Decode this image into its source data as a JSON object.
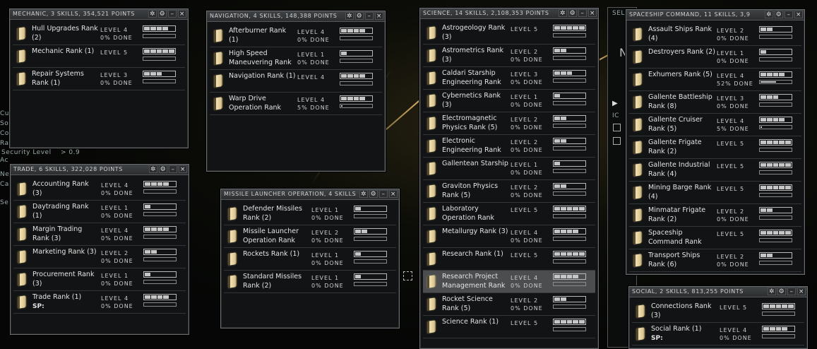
{
  "windows": {
    "mechanic": {
      "title": "MECHANIC, 3 SKILLS, 354,521 POINTS",
      "skills": [
        {
          "name": "Hull Upgrades Rank (2)",
          "level": "LEVEL 4",
          "done": "0% DONE",
          "lv": 4,
          "pct": 0
        },
        {
          "name": "Mechanic Rank (1)",
          "level": "LEVEL 5",
          "done": "",
          "lv": 5,
          "pct": 0
        },
        {
          "name": "Repair Systems Rank (1)",
          "level": "LEVEL 3",
          "done": "0% DONE",
          "lv": 3,
          "pct": 0
        }
      ]
    },
    "navigation": {
      "title": "NAVIGATION, 4 SKILLS, 148,388 POINTS",
      "skills": [
        {
          "name": "Afterburner Rank (1)",
          "level": "LEVEL 4",
          "done": "0% DONE",
          "lv": 4,
          "pct": 0
        },
        {
          "name": "High Speed Maneuvering Rank",
          "level": "LEVEL 1",
          "done": "0% DONE",
          "lv": 1,
          "pct": 0
        },
        {
          "name": "Navigation Rank (1)",
          "level": "LEVEL 4",
          "done": "",
          "lv": 4,
          "pct": 0
        },
        {
          "name": "Warp Drive Operation Rank",
          "level": "LEVEL 4",
          "done": "5% DONE",
          "lv": 4,
          "pct": 5
        }
      ]
    },
    "science": {
      "title": "SCIENCE, 14 SKILLS, 2,108,353 POINTS",
      "skills": [
        {
          "name": "Astrogeology Rank (3)",
          "level": "LEVEL 5",
          "done": "",
          "lv": 5,
          "pct": 0
        },
        {
          "name": "Astrometrics Rank (3)",
          "level": "LEVEL 2",
          "done": "0% DONE",
          "lv": 2,
          "pct": 0
        },
        {
          "name": "Caldari Starship Engineering Rank",
          "level": "LEVEL 3",
          "done": "0% DONE",
          "lv": 3,
          "pct": 0
        },
        {
          "name": "Cybernetics Rank (3)",
          "level": "LEVEL 1",
          "done": "0% DONE",
          "lv": 1,
          "pct": 0
        },
        {
          "name": "Electromagnetic Physics Rank (5)",
          "level": "LEVEL 2",
          "done": "0% DONE",
          "lv": 2,
          "pct": 0
        },
        {
          "name": "Electronic Engineering Rank",
          "level": "LEVEL 2",
          "done": "0% DONE",
          "lv": 2,
          "pct": 0
        },
        {
          "name": "Gallentean Starship",
          "level": "LEVEL 1",
          "done": "0% DONE",
          "lv": 1,
          "pct": 0
        },
        {
          "name": "Graviton Physics Rank (5)",
          "level": "LEVEL 2",
          "done": "0% DONE",
          "lv": 2,
          "pct": 0
        },
        {
          "name": "Laboratory Operation Rank",
          "level": "LEVEL 5",
          "done": "",
          "lv": 5,
          "pct": 0
        },
        {
          "name": "Metallurgy Rank (3)",
          "level": "LEVEL 4",
          "done": "0% DONE",
          "lv": 4,
          "pct": 0
        },
        {
          "name": "Research Rank (1)",
          "level": "LEVEL 5",
          "done": "",
          "lv": 5,
          "pct": 0
        },
        {
          "name": "Research Project Management Rank",
          "level": "LEVEL 4",
          "done": "0% DONE",
          "lv": 4,
          "pct": 0,
          "selected": true
        },
        {
          "name": "Rocket Science Rank (5)",
          "level": "LEVEL 2",
          "done": "0% DONE",
          "lv": 2,
          "pct": 0
        },
        {
          "name": "Science Rank (1)",
          "level": "LEVEL 5",
          "done": "",
          "lv": 5,
          "pct": 0
        }
      ]
    },
    "spaceship": {
      "title": "SPACESHIP COMMAND, 11 SKILLS, 3,9",
      "skills": [
        {
          "name": "Assault Ships Rank (4)",
          "level": "LEVEL 2",
          "done": "0% DONE",
          "lv": 2,
          "pct": 0
        },
        {
          "name": "Destroyers Rank (2)",
          "level": "LEVEL 1",
          "done": "0% DONE",
          "lv": 1,
          "pct": 0
        },
        {
          "name": "Exhumers Rank (5)",
          "level": "LEVEL 4",
          "done": "52% DONE",
          "lv": 4,
          "pct": 52
        },
        {
          "name": "Gallente Battleship Rank (8)",
          "level": "LEVEL 3",
          "done": "0% DONE",
          "lv": 3,
          "pct": 0
        },
        {
          "name": "Gallente Cruiser Rank (5)",
          "level": "LEVEL 4",
          "done": "5% DONE",
          "lv": 4,
          "pct": 5
        },
        {
          "name": "Gallente Frigate Rank (2)",
          "level": "LEVEL 5",
          "done": "",
          "lv": 5,
          "pct": 0
        },
        {
          "name": "Gallente Industrial Rank (4)",
          "level": "LEVEL 5",
          "done": "",
          "lv": 5,
          "pct": 0
        },
        {
          "name": "Mining Barge Rank (4)",
          "level": "LEVEL 5",
          "done": "",
          "lv": 5,
          "pct": 0
        },
        {
          "name": "Minmatar Frigate Rank (2)",
          "level": "LEVEL 2",
          "done": "0% DONE",
          "lv": 2,
          "pct": 0
        },
        {
          "name": "Spaceship Command Rank",
          "level": "LEVEL 5",
          "done": "",
          "lv": 5,
          "pct": 0
        },
        {
          "name": "Transport Ships Rank (6)",
          "level": "LEVEL 2",
          "done": "0% DONE",
          "lv": 2,
          "pct": 0
        }
      ]
    },
    "trade": {
      "title": "TRADE, 6 SKILLS, 322,028 POINTS",
      "skills": [
        {
          "name": "Accounting Rank (3)",
          "level": "LEVEL 4",
          "done": "0% DONE",
          "lv": 4,
          "pct": 0
        },
        {
          "name": "Daytrading Rank (1)",
          "level": "LEVEL 1",
          "done": "0% DONE",
          "lv": 1,
          "pct": 0
        },
        {
          "name": "Margin Trading Rank (3)",
          "level": "LEVEL 4",
          "done": "0% DONE",
          "lv": 4,
          "pct": 0
        },
        {
          "name": "Marketing Rank (3)",
          "level": "LEVEL 2",
          "done": "0% DONE",
          "lv": 2,
          "pct": 0
        },
        {
          "name": "Procurement Rank (3)",
          "level": "LEVEL 1",
          "done": "0% DONE",
          "lv": 1,
          "pct": 0
        },
        {
          "name": "Trade Rank (1)",
          "level": "LEVEL 4",
          "done": "0% DONE",
          "lv": 4,
          "pct": 0,
          "sp": "SP:"
        }
      ]
    },
    "missile": {
      "title": "MISSILE LAUNCHER OPERATION, 4 SKILLS",
      "skills": [
        {
          "name": "Defender Missiles Rank (2)",
          "level": "LEVEL 1",
          "done": "0% DONE",
          "lv": 1,
          "pct": 0
        },
        {
          "name": "Missile Launcher Operation Rank",
          "level": "LEVEL 2",
          "done": "0% DONE",
          "lv": 2,
          "pct": 0
        },
        {
          "name": "Rockets Rank (1)",
          "level": "LEVEL 1",
          "done": "0% DONE",
          "lv": 1,
          "pct": 0
        },
        {
          "name": "Standard Missiles Rank (2)",
          "level": "LEVEL 1",
          "done": "0% DONE",
          "lv": 1,
          "pct": 0
        }
      ]
    },
    "social": {
      "title": "SOCIAL, 2 SKILLS, 813,255 POINTS",
      "skills": [
        {
          "name": "Connections Rank (3)",
          "level": "LEVEL 5",
          "done": "",
          "lv": 5,
          "pct": 0
        },
        {
          "name": "Social Rank (1)",
          "level": "LEVEL 4",
          "done": "0% DONE",
          "lv": 4,
          "pct": 0,
          "sp": "SP:"
        }
      ]
    }
  },
  "background": {
    "security_label": "Security Level",
    "security_value": "> 0.9",
    "side_labels": [
      "Cu",
      "So",
      "Co",
      "Ra",
      "Ac",
      "Ne",
      "Ca",
      "Se"
    ],
    "sel_label": "SEL",
    "n_label": "N",
    "ic_label": "IC"
  },
  "colors": {
    "accent": "#ffd27a",
    "window_bg": "#121314",
    "border": "#6b6e70"
  }
}
